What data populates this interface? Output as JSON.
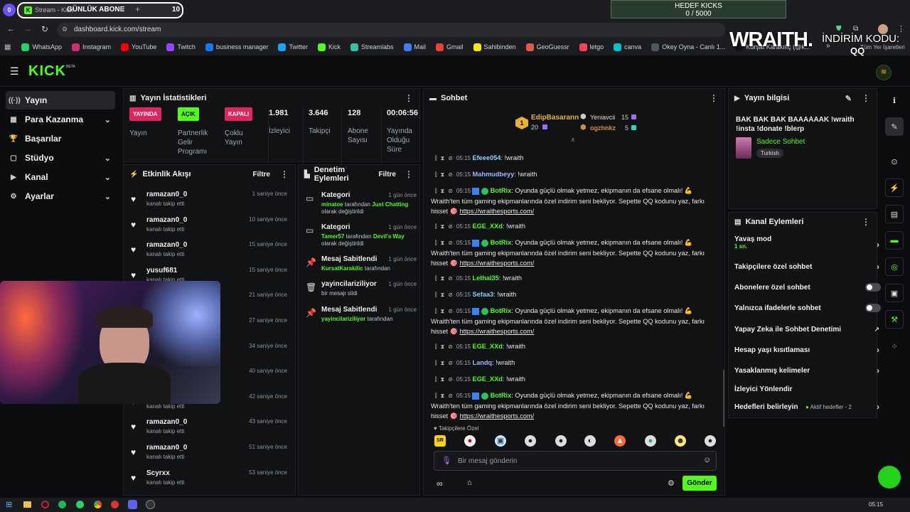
{
  "browser": {
    "tab_badge": "0",
    "tab_title": "Stream - Kick",
    "overlay_title": "GÜNLÜK ABONE",
    "overlay_count": "10",
    "tab_close": "✕",
    "new_tab": "+",
    "url": "dashboard.kick.com/stream",
    "bookmarks": [
      {
        "label": "WhatsApp",
        "color": "#25d366"
      },
      {
        "label": "Instagram",
        "color": "#d62976"
      },
      {
        "label": "YouTube",
        "color": "#ff0000"
      },
      {
        "label": "Twitch",
        "color": "#9146ff"
      },
      {
        "label": "business manager",
        "color": "#1877f2"
      },
      {
        "label": "Twitter",
        "color": "#1da1f2"
      },
      {
        "label": "Kick",
        "color": "#53fc18"
      },
      {
        "label": "Streamlabs",
        "color": "#31c3a2"
      },
      {
        "label": "Mail",
        "color": "#3b82f6"
      },
      {
        "label": "Gmail",
        "color": "#ea4335"
      },
      {
        "label": "Sahibinden",
        "color": "#ffe800"
      },
      {
        "label": "GeoGuessr",
        "color": "#e05a47"
      },
      {
        "label": "letgo",
        "color": "#ff3f55"
      },
      {
        "label": "canva",
        "color": "#00c4cc"
      },
      {
        "label": "Okey Oyna - Canlı 1...",
        "color": "#4b5563"
      },
      {
        "label": "Kürşat Karakılıç (@k...",
        "color": "#111111"
      }
    ],
    "bookmarks_more": "»",
    "bookmarks_other": "Tüm Yer İşaretleri"
  },
  "overlay": {
    "goal_title": "HEDEF KICKS",
    "goal_value": "0 / 5000",
    "brand": "WRAITH.",
    "promo": "İNDİRİM KODU:",
    "promo_code": "QQ"
  },
  "kick": {
    "logo": "KICK",
    "logo_sup": "BETA"
  },
  "sidebar": {
    "items": [
      {
        "label": "Yayın",
        "icon": "((·))"
      },
      {
        "label": "Para Kazanma",
        "icon": "▦"
      },
      {
        "label": "Başarılar",
        "icon": "🏆"
      },
      {
        "label": "Stüdyo",
        "icon": "▢"
      },
      {
        "label": "Kanal",
        "icon": "▶"
      },
      {
        "label": "Ayarlar",
        "icon": "⚙"
      }
    ]
  },
  "stats": {
    "title": "Yayın İstatistikleri",
    "badges": [
      {
        "badge": "YAYINDA",
        "label": "Yayın",
        "color": "#e0245e"
      },
      {
        "badge": "AÇIK",
        "label": "Partnerlik Gelir Programı",
        "color": "#53fc18"
      },
      {
        "badge": "KAPALI",
        "label": "Çoklu Yayın",
        "color": "#e0245e"
      }
    ],
    "values": [
      {
        "value": "1.981",
        "label": "İzleyici"
      },
      {
        "value": "3.646",
        "label": "Takipçi"
      },
      {
        "value": "128",
        "label": "Abone Sayısı"
      },
      {
        "value": "00:06:56",
        "label": "Yayında Olduğu Süre"
      }
    ]
  },
  "activity": {
    "title": "Etkinlik Akışı",
    "filter": "Filtre",
    "items": [
      {
        "name": "ramazan0_0",
        "sub": "kanalı takip etti",
        "time": "1 saniye önce"
      },
      {
        "name": "ramazan0_0",
        "sub": "kanalı takip etti",
        "time": "10 saniye önce"
      },
      {
        "name": "ramazan0_0",
        "sub": "kanalı takip etti",
        "time": "15 saniye önce"
      },
      {
        "name": "yusuf681",
        "sub": "kanalı takip etti",
        "time": "15 saniye önce"
      },
      {
        "name": "",
        "sub": "",
        "time": "21 saniye önce"
      },
      {
        "name": "",
        "sub": "",
        "time": "27 saniye önce"
      },
      {
        "name": "",
        "sub": "",
        "time": "34 saniye önce"
      },
      {
        "name": "",
        "sub": "",
        "time": "40 saniye önce"
      },
      {
        "name": "",
        "sub": "kanalı takip etti",
        "time": "42 saniye önce"
      },
      {
        "name": "ramazan0_0",
        "sub": "kanalı takip etti",
        "time": "43 saniye önce"
      },
      {
        "name": "ramazan0_0",
        "sub": "kanalı takip etti",
        "time": "51 saniye önce"
      },
      {
        "name": "Scyrxx",
        "sub": "kanalı takip etti",
        "time": "53 saniye önce"
      }
    ]
  },
  "moderation": {
    "title": "Denetim Eylemleri",
    "filter": "Filtre",
    "items": [
      {
        "title": "Kategori",
        "time": "1 gün önce",
        "user": "minatoe",
        "mid": " tarafından ",
        "target": "Just Chatting",
        "end": " olarak değiştirildi",
        "icon": "▭"
      },
      {
        "title": "Kategori",
        "time": "1 gün önce",
        "user": "Tamer57",
        "mid": " tarafından ",
        "target": "Devil's Way",
        "end": " olarak değiştirildi",
        "icon": "▭"
      },
      {
        "title": "Mesaj Sabitlendi",
        "time": "1 gün önce",
        "user": "KursatKarakilic",
        "mid": " tarafından",
        "target": "",
        "end": "",
        "icon": "📌"
      },
      {
        "title": "yayincilariziliyor",
        "time": "1 gün önce",
        "user": "",
        "mid": "bir mesajı sildi",
        "target": "",
        "end": "",
        "icon": "🗑"
      },
      {
        "title": "Mesaj Sabitlendi",
        "time": "1 gün önce",
        "user": "yayincilariziliyor",
        "mid": " tarafından",
        "target": "",
        "end": "",
        "icon": "📌"
      }
    ]
  },
  "chat": {
    "title": "Sohbet",
    "top_gifters": [
      {
        "rank": "1",
        "name": "EdipBasarann",
        "count": "20"
      },
      {
        "name": "Yeniavcii",
        "count": "15"
      },
      {
        "name": "ogzhnkz",
        "count": "5"
      }
    ],
    "messages": [
      {
        "time": "05:15",
        "user": "Efeee054",
        "color": "#8fd3ff",
        "text": ": !wraith",
        "link": ""
      },
      {
        "time": "05:15",
        "user": "Mahmudbeyy",
        "color": "#9fb7ff",
        "text": ": !wraith",
        "link": ""
      },
      {
        "time": "05:15",
        "user": "BotRix",
        "color": "#53fc18",
        "text": ": Oyunda güçlü olmak yetmez, ekipmanın da efsane olmalı! 💪 Wraith'ten tüm gaming ekipmanlarında özel indirim seni bekliyor. Sepette QQ kodunu yaz, farkı hisset 🎯 ",
        "link": "https://wraithesports.com/"
      },
      {
        "time": "05:15",
        "user": "EGE_XXd",
        "color": "#53fc18",
        "text": ": !wraith",
        "link": ""
      },
      {
        "time": "05:15",
        "user": "BotRix",
        "color": "#53fc18",
        "text": ": Oyunda güçlü olmak yetmez, ekipmanın da efsane olmalı! 💪 Wraith'ten tüm gaming ekipmanlarında özel indirim seni bekliyor. Sepette QQ kodunu yaz, farkı hisset 🎯 ",
        "link": "https://wraithesports.com/"
      },
      {
        "time": "05:15",
        "user": "Lethal35",
        "color": "#53fc18",
        "text": ": !wraith",
        "link": ""
      },
      {
        "time": "05:15",
        "user": "Sefaa3",
        "color": "#7fd1ff",
        "text": ": !wraith",
        "link": ""
      },
      {
        "time": "05:15",
        "user": "BotRix",
        "color": "#53fc18",
        "text": ": Oyunda güçlü olmak yetmez, ekipmanın da efsane olmalı! 💪 Wraith'ten tüm gaming ekipmanlarında özel indirim seni bekliyor. Sepette QQ kodunu yaz, farkı hisset 🎯 ",
        "link": "https://wraithesports.com/"
      },
      {
        "time": "05:15",
        "user": "EGE_XXd",
        "color": "#53fc18",
        "text": ": !wraith",
        "link": ""
      },
      {
        "time": "05:15",
        "user": "Landq",
        "color": "#9fb7ff",
        "text": ": !wraith",
        "link": ""
      },
      {
        "time": "05:15",
        "user": "EGE_XXd",
        "color": "#53fc18",
        "text": ": !wraith",
        "link": ""
      },
      {
        "time": "05:15",
        "user": "BotRix",
        "color": "#53fc18",
        "text": ": Oyunda güçlü olmak yetmez, ekipmanın da efsane olmalı! 💪 Wraith'ten tüm gaming ekipmanlarında özel indirim seni bekliyor. Sepette QQ kodunu yaz, farkı hisset 🎯 ",
        "link": "https://wraithesports.com/"
      }
    ],
    "followers_only": "Takipçilere Özel",
    "input_placeholder": "Bir mesaj gönderin",
    "send": "Gönder"
  },
  "stream_info": {
    "title": "Yayın bilgisi",
    "stream_title": "BAK BAK BAK BAAAAAAK !wraith !insta !donate !blerp",
    "category": "Sadece Sohbet",
    "tag": "Turkish"
  },
  "channel_actions": {
    "title": "Kanal Eylemleri",
    "items": [
      {
        "label": "Yavaş mod",
        "sub": "1 sn.",
        "control": "chevron"
      },
      {
        "label": "Takipçilere özel sohbet",
        "sub": "",
        "control": "chevron"
      },
      {
        "label": "Abonelere özel sohbet",
        "sub": "",
        "control": "toggle"
      },
      {
        "label": "Yalnızca ifadelerle sohbet",
        "sub": "",
        "control": "toggle"
      },
      {
        "label": "Yapay Zeka ile Sohbet Denetimi",
        "sub": "",
        "control": "external"
      },
      {
        "label": "Hesap yaşı kısıtlaması",
        "sub": "",
        "control": "chevron"
      },
      {
        "label": "Yasaklanmış kelimeler",
        "sub": "",
        "control": "chevron"
      },
      {
        "label": "İzleyici Yönlendir",
        "sub": "",
        "control": "none"
      },
      {
        "label": "Hedefleri belirleyin",
        "sub": "",
        "control": "chevron",
        "extra": "Aktif hedefler - 2"
      }
    ]
  },
  "taskbar": {
    "time": "05:15"
  }
}
